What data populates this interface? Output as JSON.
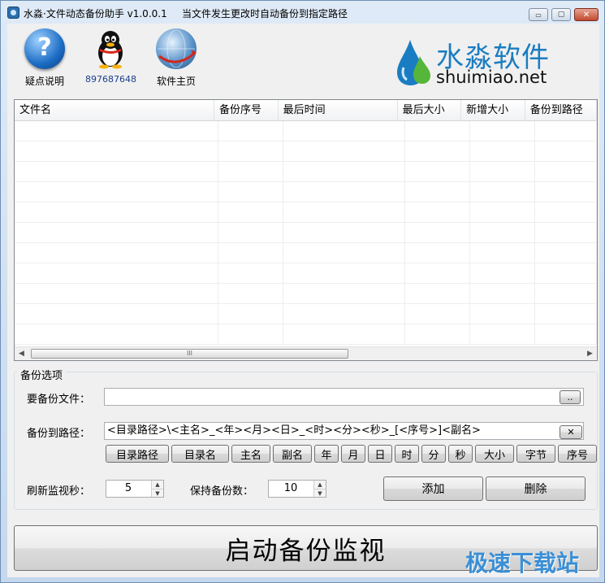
{
  "window": {
    "title": "水淼·文件动态备份助手 v1.0.0.1",
    "subtitle": "当文件发生更改时自动备份到指定路径",
    "controls": {
      "minimize": "▭",
      "maximize": "▢",
      "close": "✕"
    }
  },
  "toolbar": {
    "help_label": "疑点说明",
    "qq_label": "897687648",
    "home_label": "软件主页"
  },
  "logo": {
    "name": "水淼软件",
    "url": "shuimiao.net"
  },
  "table": {
    "columns": [
      "文件名",
      "备份序号",
      "最后时间",
      "最后大小",
      "新增大小",
      "备份到路径"
    ],
    "rows": [],
    "scroll_thumb": "III"
  },
  "options": {
    "group_title": "备份选项",
    "source_label": "要备份文件：",
    "source_value": "",
    "browse_label": "..",
    "dest_label": "备份到路径：",
    "dest_value": "<目录路径>\\<主名>_<年><月><日>_<时><分><秒>_[<序号>]<副名>",
    "clear_label": "✕",
    "tokens": [
      "目录路径",
      "目录名",
      "主名",
      "副名",
      "年",
      "月",
      "日",
      "时",
      "分",
      "秒",
      "大小",
      "字节",
      "序号"
    ],
    "refresh_label": "刷新监视秒：",
    "refresh_value": "5",
    "keep_label": "保持备份数：",
    "keep_value": "10",
    "add_label": "添加",
    "delete_label": "删除"
  },
  "start_button": "启动备份监视",
  "watermark": "极速下载站",
  "colors": {
    "logo_blue": "#1b7dc1",
    "watermark_blue": "#3a8fd6"
  }
}
